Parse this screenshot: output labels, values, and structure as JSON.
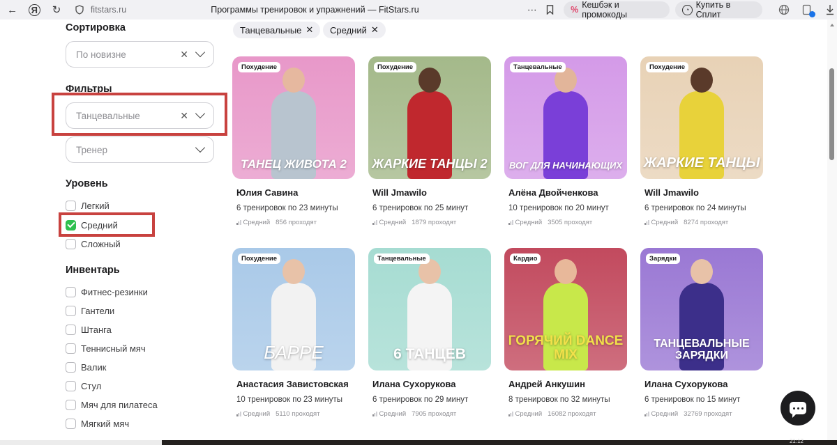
{
  "browser": {
    "domain": "fitstars.ru",
    "page_title": "Программы тренировок и упражнений — FitStars.ru",
    "cashback_button": "Кешбэк и промокоды",
    "split_button": "Купить в Сплит",
    "clock": "21:12"
  },
  "sidebar": {
    "sort_heading": "Сортировка",
    "sort_value": "По новизне",
    "filters_heading": "Фильтры",
    "category_value": "Танцевальные",
    "trainer_placeholder": "Тренер",
    "level_heading": "Уровень",
    "levels": [
      {
        "label": "Легкий",
        "checked": false
      },
      {
        "label": "Средний",
        "checked": true
      },
      {
        "label": "Сложный",
        "checked": false
      }
    ],
    "inventory_heading": "Инвентарь",
    "inventory": [
      {
        "label": "Фитнес-резинки",
        "checked": false
      },
      {
        "label": "Гантели",
        "checked": false
      },
      {
        "label": "Штанга",
        "checked": false
      },
      {
        "label": "Теннисный мяч",
        "checked": false
      },
      {
        "label": "Валик",
        "checked": false
      },
      {
        "label": "Стул",
        "checked": false
      },
      {
        "label": "Мяч для пилатеса",
        "checked": false
      },
      {
        "label": "Мягкий мяч",
        "checked": false
      }
    ]
  },
  "chips": [
    {
      "label": "Танцевальные"
    },
    {
      "label": "Средний"
    }
  ],
  "cards": [
    {
      "tag": "Похудение",
      "cover_title": "ТАНЕЦ ЖИВОТА 2",
      "trainer": "Юлия Савина",
      "sessions": "6 тренировок по 23 минуты",
      "level": "Средний",
      "count": "856 проходят",
      "bg": "#e898c9",
      "skin": "#e6b89f",
      "outfit": "#b8c4cf"
    },
    {
      "tag": "Похудение",
      "cover_title": "ЖАРКИЕ ТАНЦЫ 2",
      "trainer": "Will Jmawilo",
      "sessions": "6 тренировок по 25 минут",
      "level": "Средний",
      "count": "1879 проходят",
      "bg": "#a4b98a",
      "skin": "#5a3a2a",
      "outfit": "#c0282e"
    },
    {
      "tag": "Танцевальные",
      "cover_title": "ВОГ ДЛЯ НАЧИНАЮЩИХ",
      "trainer": "Алёна Двойченкова",
      "sessions": "10 тренировок по 20 минут",
      "level": "Средний",
      "count": "3505 проходят",
      "bg": "#d49ae8",
      "skin": "#e2b59a",
      "outfit": "#7a3fd8"
    },
    {
      "tag": "Похудение",
      "cover_title": "ЖАРКИЕ ТАНЦЫ",
      "trainer": "Will Jmawilo",
      "sessions": "6 тренировок по 24 минуты",
      "level": "Средний",
      "count": "8274 проходят",
      "bg": "#e8d2b6",
      "skin": "#5a3a2a",
      "outfit": "#e8d23a"
    },
    {
      "tag": "Похудение",
      "cover_title": "БАРРЕ",
      "trainer": "Анастасия Завистовская",
      "sessions": "10 тренировок по 23 минуты",
      "level": "Средний",
      "count": "5110 проходят",
      "bg": "#a9c9e8",
      "skin": "#e8c2a8",
      "outfit": "#f2f2f2"
    },
    {
      "tag": "Танцевальные",
      "cover_title": "6 ТАНЦЕВ",
      "trainer": "Илана Сухорукова",
      "sessions": "6 тренировок по 29 минут",
      "level": "Средний",
      "count": "7905 проходят",
      "bg": "#a6dcd2",
      "skin": "#e8c2a8",
      "outfit": "#f4f4f4"
    },
    {
      "tag": "Кардио",
      "cover_title": "ГОРЯЧИЙ DANCE MIX",
      "trainer": "Андрей Анкушин",
      "sessions": "8 тренировок по 32 минуты",
      "level": "Средний",
      "count": "16082 проходят",
      "bg": "#c24a5e",
      "skin": "#e8b89a",
      "outfit": "#c8e84a"
    },
    {
      "tag": "Зарядки",
      "cover_title": "ТАНЦЕВАЛЬНЫЕ ЗАРЯДКИ",
      "trainer": "Илана Сухорукова",
      "sessions": "6 тренировок по 15 минут",
      "level": "Средний",
      "count": "32769 проходят",
      "bg": "#9a78d4",
      "skin": "#e8c2a8",
      "outfit": "#3c2f8a"
    }
  ]
}
